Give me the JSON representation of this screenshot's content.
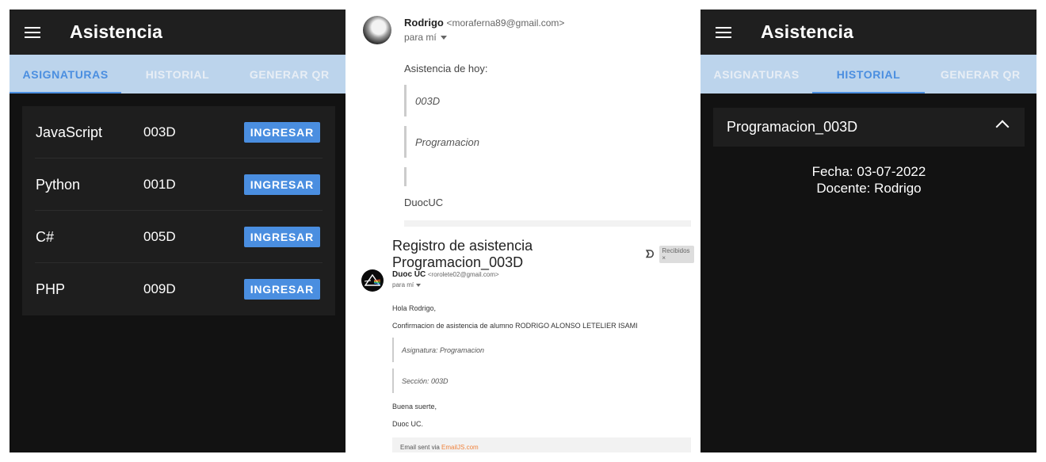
{
  "app_left": {
    "title": "Asistencia",
    "tabs": [
      {
        "label": "ASIGNATURAS",
        "active": true
      },
      {
        "label": "HISTORIAL",
        "active": false
      },
      {
        "label": "GENERAR QR",
        "active": false
      }
    ],
    "subjects": [
      {
        "name": "JavaScript",
        "code": "003D",
        "action": "INGRESAR"
      },
      {
        "name": "Python",
        "code": "001D",
        "action": "INGRESAR"
      },
      {
        "name": "C#",
        "code": "005D",
        "action": "INGRESAR"
      },
      {
        "name": "PHP",
        "code": "009D",
        "action": "INGRESAR"
      }
    ]
  },
  "email": {
    "first_message": {
      "sender_name": "Rodrigo",
      "sender_email": "<moraferna89@gmail.com>",
      "to": "para mí",
      "intro": "Asistencia de hoy:",
      "quotes": [
        "003D",
        "Programacion",
        ""
      ],
      "signature": "DuocUC"
    },
    "subject": "Registro de asistencia Programacion_003D",
    "label": "Recibidos ×",
    "second_message": {
      "sender_name": "Duoc UC",
      "sender_email": "<rorolete02@gmail.com>",
      "to": "para mí",
      "greeting": "Hola Rodrigo,",
      "body": "Confirmacion de asistencia de alumno RODRIGO ALONSO LETELIER ISAMI",
      "quotes": [
        "Asignatura: Programacion",
        "Sección: 003D"
      ],
      "closing": "Buena suerte,",
      "signature": "Duoc UC.",
      "footer_prefix": "Email sent via",
      "footer_link": "EmailJS.com"
    }
  },
  "app_right": {
    "title": "Asistencia",
    "tabs": [
      {
        "label": "ASIGNATURAS",
        "active": false
      },
      {
        "label": "HISTORIAL",
        "active": true
      },
      {
        "label": "GENERAR QR",
        "active": false
      }
    ],
    "history_item": {
      "title": "Programacion_003D",
      "date_line": "Fecha: 03-07-2022",
      "teacher_line": "Docente: Rodrigo"
    }
  },
  "colors": {
    "accent": "#4a8ee0",
    "tab_bar": "#bcd4ec",
    "toolbar": "#1f1f1f",
    "background": "#121212",
    "card": "#1e1e1e",
    "link": "#f0823c"
  },
  "icons": [
    "menu-icon",
    "chevron-up-icon",
    "important-marker-icon",
    "dropdown-caret-icon"
  ]
}
